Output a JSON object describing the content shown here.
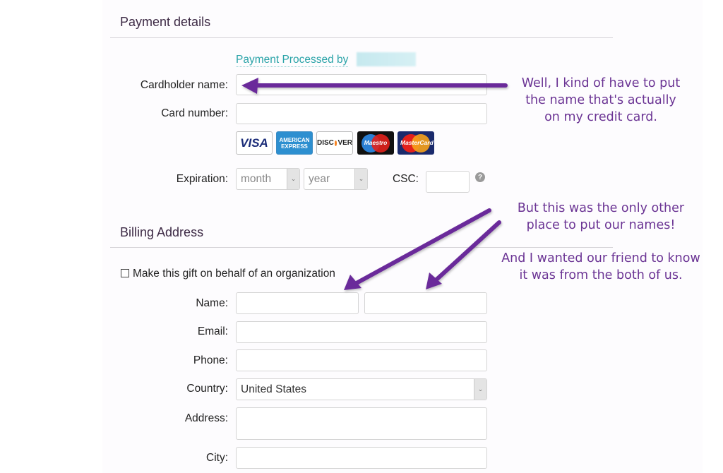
{
  "payment": {
    "title": "Payment details",
    "processed_by": "Payment Processed by",
    "cardholder_label": "Cardholder name:",
    "cardholder_value": "",
    "card_number_label": "Card number:",
    "card_number_value": "",
    "cards": {
      "visa": "VISA",
      "amex_line1": "AMERICAN",
      "amex_line2": "EXPRESS",
      "discover_pre": "DISC",
      "discover_post": "VER",
      "maestro": "Maestro",
      "mastercard": "MasterCard"
    },
    "expiration_label": "Expiration:",
    "month_selected": "month",
    "year_selected": "year",
    "csc_label": "CSC:",
    "csc_value": "",
    "help_glyph": "?"
  },
  "billing": {
    "title": "Billing Address",
    "organization_checkbox_label": "Make this gift on behalf of an organization",
    "name_label": "Name:",
    "first_name_value": "",
    "last_name_value": "",
    "email_label": "Email:",
    "email_value": "",
    "phone_label": "Phone:",
    "phone_value": "",
    "country_label": "Country:",
    "country_selected": "United States",
    "address_label": "Address:",
    "address_value": "",
    "city_label": "City:",
    "city_value": ""
  },
  "annotations": {
    "color": "#6a2c9a",
    "note1": [
      "Well, I kind of have to put",
      "the name that's actually",
      "on my credit card."
    ],
    "note2": [
      "But this was the only other",
      "place to put our names!"
    ],
    "note3": [
      "And I wanted our friend to know",
      "it was from the both of us."
    ]
  }
}
